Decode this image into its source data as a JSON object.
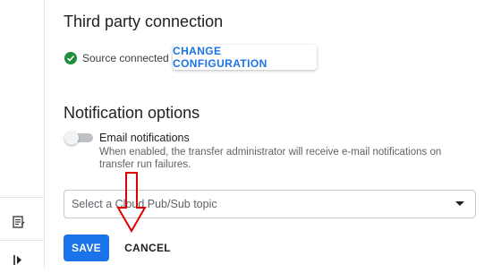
{
  "sections": {
    "third_party": {
      "title": "Third party connection",
      "status_text": "Source connected",
      "change_button": "CHANGE CONFIGURATION"
    },
    "notifications": {
      "title": "Notification options",
      "email_toggle": {
        "label": "Email notifications",
        "enabled": false
      },
      "help_text": "When enabled, the transfer administrator will receive e-mail notifications on transfer run failures.",
      "pubsub_select": {
        "placeholder": "Select a Cloud Pub/Sub topic"
      }
    }
  },
  "actions": {
    "save": "SAVE",
    "cancel": "CANCEL"
  },
  "colors": {
    "accent": "#1a73e8",
    "success": "#1e8e3e",
    "annotation_arrow": "#e00000"
  },
  "icons": [
    "release-notes-icon",
    "expand-panel-icon",
    "check-circle-icon",
    "dropdown-caret-icon"
  ]
}
